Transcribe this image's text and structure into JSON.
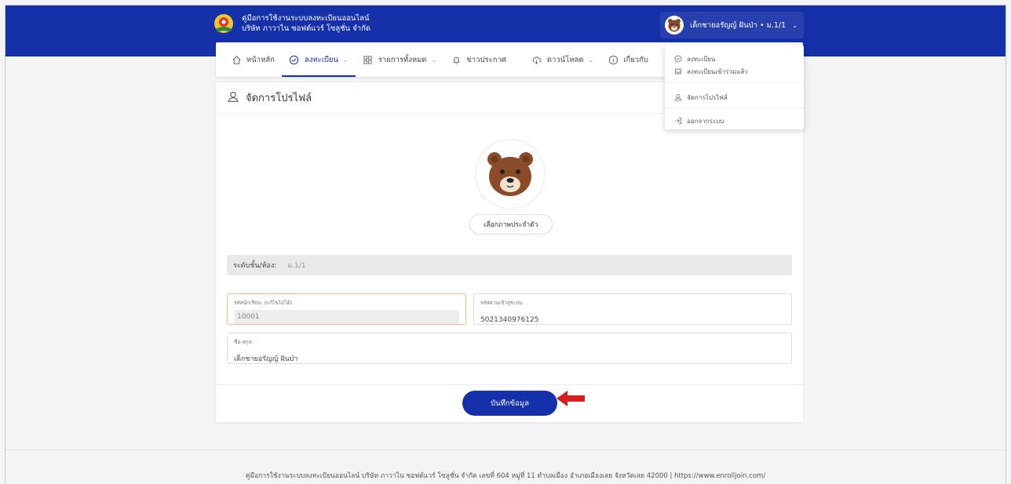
{
  "header": {
    "brand_line1": "คู่มือการใช้งานระบบลงทะเบียนออนไลน์",
    "brand_line2": "บริษัท ภาวาไน ซอฟต์แวร์ โซลูชั่น จำกัด",
    "user_name": "เด็กชายอรัญญ์ ฝันป่า • ม.1/1"
  },
  "nav": {
    "items": [
      {
        "label": "หน้าหลัก",
        "icon": "home-icon"
      },
      {
        "label": "ลงทะเบียน",
        "icon": "check-circle-icon"
      },
      {
        "label": "รายการทั้งหมด",
        "icon": "grid-icon"
      },
      {
        "label": "ข่าวประกาศ",
        "icon": "bell-icon"
      },
      {
        "label": "ดาวน์โหลด",
        "icon": "cloud-download-icon"
      },
      {
        "label": "เกี่ยวกับ",
        "icon": "info-icon"
      }
    ]
  },
  "dropdown": {
    "items": [
      {
        "label": "ลงทะเบียน",
        "icon": "check-circle-icon"
      },
      {
        "label": "ลงทะเบียนเข้าร่วมแล้ว",
        "icon": "inbox-icon"
      },
      {
        "label": "จัดการโปรไฟล์",
        "icon": "user-icon"
      },
      {
        "label": "ออกจากระบบ",
        "icon": "logout-icon"
      }
    ]
  },
  "profile": {
    "title": "จัดการโปรไฟล์",
    "choose_photo": "เลือกภาพประจำตัว",
    "grade_label": "ระดับชั้น/ห้อง:",
    "grade_value": "ม.1/1",
    "student_id_label": "รหัสนักเรียน: (แก้ไขไม่ได้)",
    "student_id_value": "10001",
    "password_label": "รหัสผ่านเข้าสู่ระบบ:",
    "password_value": "5021340976125",
    "name_label": "ชื่อ-สกุล:",
    "name_value": "เด็กชายอรัญญ์ ฝันป่า",
    "save_label": "บันทึกข้อมูล"
  },
  "footer": {
    "text": "คู่มือการใช้งานระบบลงทะเบียนออนไลน์ บริษัท ภาวาไน ซอฟต์แวร์ โซลูชั่น จำกัด เลขที่ 604 หมู่ที่ 11 ตำบลเมือง อำเภอเมืองเลย จังหวัดเลย 42000 | https://www.enrolljoin.com/"
  },
  "colors": {
    "primary": "#1530a8",
    "arrow": "#d61f1f"
  }
}
